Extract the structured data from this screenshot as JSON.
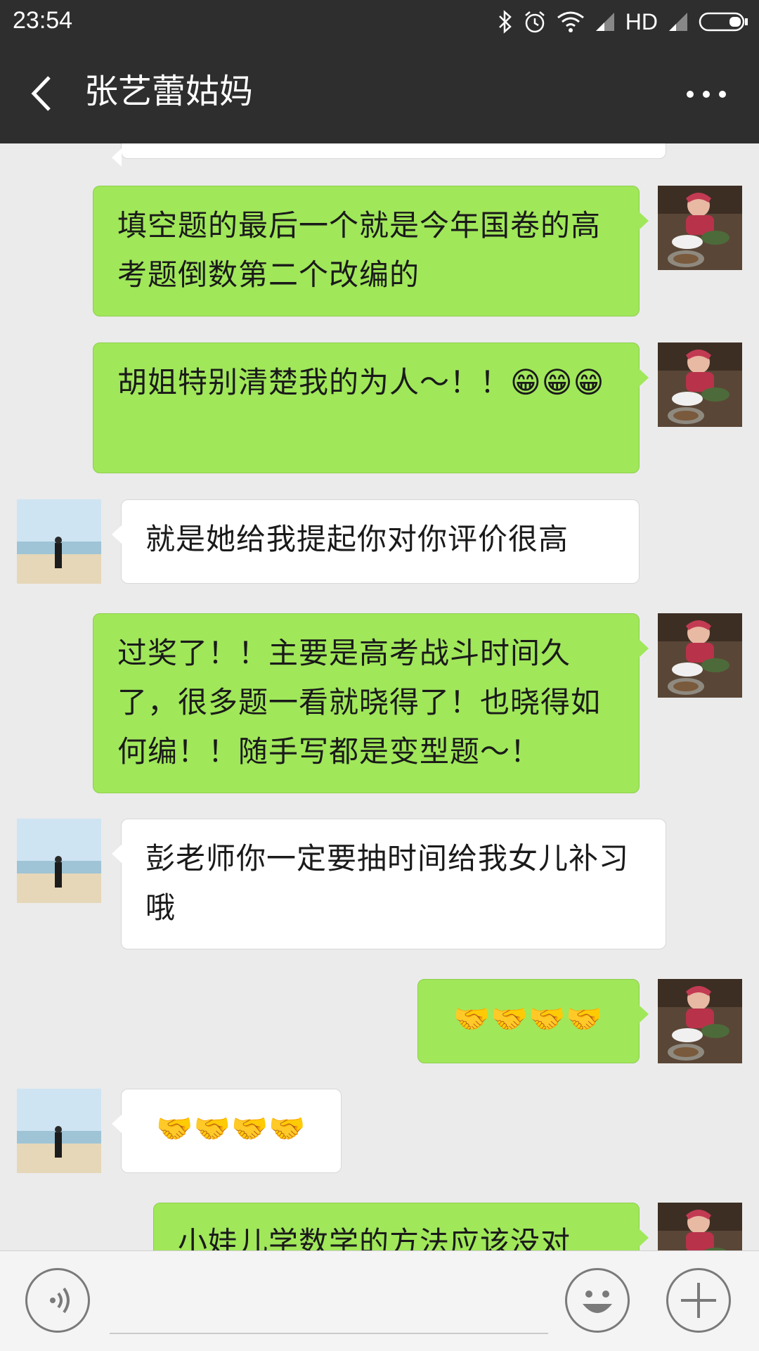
{
  "status_bar": {
    "time": "23:54",
    "network_label": "HD"
  },
  "header": {
    "title": "张艺蕾姑妈",
    "back_icon": "chevron-left-icon",
    "more_icon": "more-dots-icon"
  },
  "messages": [
    {
      "side": "me",
      "text": "填空题的最后一个就是今年国卷的高考题倒数第二个改编的"
    },
    {
      "side": "me",
      "text": "胡姐特别清楚我的为人～！！😁😁😁"
    },
    {
      "side": "them",
      "text": "就是她给我提起你对你评价很高"
    },
    {
      "side": "me",
      "text": "过奖了！！主要是高考战斗时间久了，很多题一看就晓得了！也晓得如何编！！随手写都是变型题～！"
    },
    {
      "side": "them",
      "text": "彭老师你一定要抽时间给我女儿补习哦"
    },
    {
      "side": "me",
      "text": "🤝🤝🤝🤝"
    },
    {
      "side": "them",
      "text": "🤝🤝🤝🤝"
    },
    {
      "side": "me",
      "text": "小娃儿学数学的方法应该没对"
    }
  ],
  "input_bar": {
    "voice_icon": "voice-icon",
    "emoji_icon": "emoji-icon",
    "add_icon": "plus-icon"
  }
}
